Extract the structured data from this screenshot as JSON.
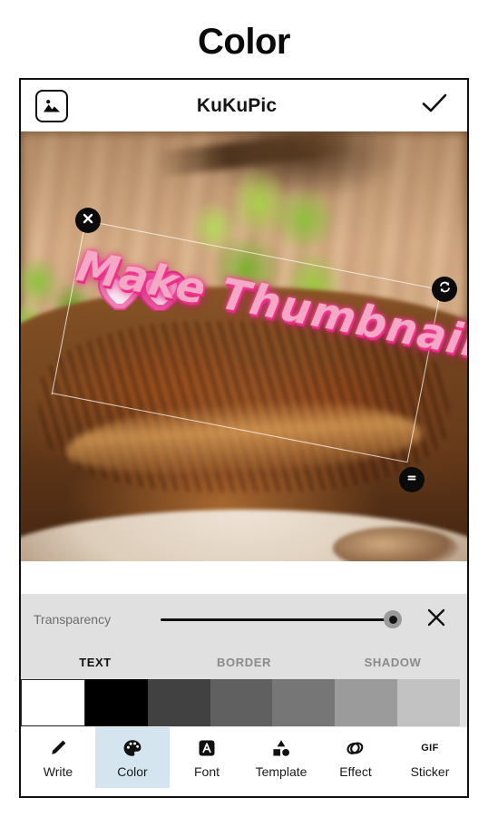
{
  "page_heading": "Color",
  "app_header": {
    "gallery_icon": "image-icon",
    "title": "KuKuPic",
    "confirm_icon": "check-icon"
  },
  "canvas": {
    "overlay_text": "Make Thumbnails",
    "overlay_text_color": "#f3a8c6",
    "overlay_glow_color": "#ff2e93",
    "decoration": "double-heart-sticker",
    "handles": [
      {
        "name": "delete-handle",
        "icon": "close-icon",
        "position": "top-left"
      },
      {
        "name": "rotate-handle",
        "icon": "rotate-icon",
        "position": "right"
      },
      {
        "name": "resize-handle",
        "icon": "equals-icon",
        "position": "bottom-right"
      }
    ]
  },
  "transparency": {
    "label": "Transparency",
    "value": 100,
    "close_icon": "close-icon"
  },
  "tabs": [
    {
      "label": "TEXT",
      "active": true
    },
    {
      "label": "BORDER",
      "active": false
    },
    {
      "label": "SHADOW",
      "active": false
    }
  ],
  "swatches": [
    {
      "name": "swatch-white",
      "color": "#ffffff"
    },
    {
      "name": "swatch-black",
      "color": "#000000"
    },
    {
      "name": "swatch-gray-1",
      "color": "#414141"
    },
    {
      "name": "swatch-gray-2",
      "color": "#606060"
    },
    {
      "name": "swatch-gray-3",
      "color": "#767676"
    },
    {
      "name": "swatch-gray-4",
      "color": "#9b9b9b"
    },
    {
      "name": "swatch-gray-5",
      "color": "#c2c2c2"
    }
  ],
  "bottom_nav": [
    {
      "label": "Write",
      "icon": "pencil-icon",
      "selected": false
    },
    {
      "label": "Color",
      "icon": "palette-icon",
      "selected": true
    },
    {
      "label": "Font",
      "icon": "font-a-icon",
      "selected": false
    },
    {
      "label": "Template",
      "icon": "shapes-icon",
      "selected": false
    },
    {
      "label": "Effect",
      "icon": "layers-icon",
      "selected": false
    },
    {
      "label": "Sticker",
      "icon": "gif-icon",
      "selected": false
    }
  ],
  "colors": {
    "selected_nav_bg": "#d4e5ef",
    "panel_bg": "#e0e0e0",
    "accent_text": "#111111"
  }
}
